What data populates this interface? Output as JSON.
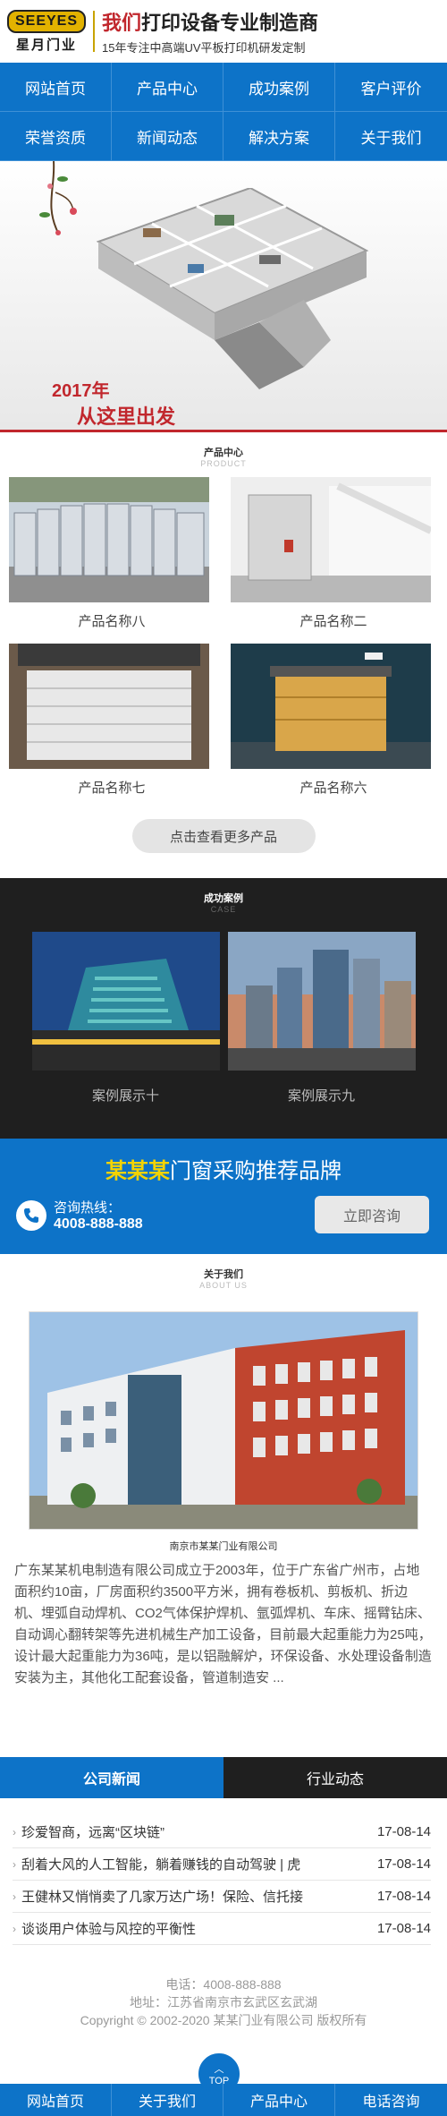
{
  "header": {
    "logo_top": "SEEYES",
    "logo_bottom": "星月门业",
    "headline_red": "我们",
    "headline_rest": "打印设备专业制造商",
    "subline": "15年专注中高端UV平板打印机研发定制"
  },
  "nav": [
    "网站首页",
    "产品中心",
    "成功案例",
    "客户评价",
    "荣誉资质",
    "新闻动态",
    "解决方案",
    "关于我们"
  ],
  "banner": {
    "year": "2017年",
    "slogan": "从这里出发"
  },
  "products": {
    "title": "产品中心",
    "subtitle": "PRODUCT",
    "items": [
      "产品名称八",
      "产品名称二",
      "产品名称七",
      "产品名称六"
    ],
    "more": "点击查看更多产品"
  },
  "cases": {
    "title": "成功案例",
    "subtitle": "CASE",
    "items": [
      "案例展示十",
      "案例展示九"
    ]
  },
  "hotline": {
    "brand": "某某某",
    "title_rest": "门窗采购推荐品牌",
    "label": "咨询热线：",
    "number": "4008-888-888",
    "button": "立即咨询"
  },
  "about": {
    "title": "关于我们",
    "subtitle": "ABOUT US",
    "caption": "南京市某某门业有限公司",
    "text": "广东某某机电制造有限公司成立于2003年，位于广东省广州市，占地面积约10亩，厂房面积约3500平方米，拥有卷板机、剪板机、折边机、埋弧自动焊机、CO2气体保护焊机、氩弧焊机、车床、摇臂钻床、自动调心翻转架等先进机械生产加工设备，目前最大起重能力为25吨，设计最大起重能力为36吨，是以铝融解炉，环保设备、水处理设备制造安装为主，其他化工配套设备，管道制造安 ..."
  },
  "news": {
    "tabs": [
      "公司新闻",
      "行业动态"
    ],
    "items": [
      {
        "title": "珍爱智商，远离“区块链”",
        "date": "17-08-14"
      },
      {
        "title": "刮着大风的人工智能，躺着赚钱的自动驾驶 | 虎",
        "date": "17-08-14"
      },
      {
        "title": "王健林又悄悄卖了几家万达广场！保险、信托接",
        "date": "17-08-14"
      },
      {
        "title": "谈谈用户体验与风控的平衡性",
        "date": "17-08-14"
      }
    ]
  },
  "footer": {
    "phone": "电话：4008-888-888",
    "address": "地址：江苏省南京市玄武区玄武湖",
    "copyright": "Copyright © 2002-2020 某某门业有限公司 版权所有"
  },
  "bottom_bar": [
    "网站首页",
    "关于我们",
    "产品中心",
    "电话咨询"
  ],
  "top_button": "TOP",
  "colors": {
    "primary": "#0d73c8",
    "accent_red": "#c1272d",
    "dark": "#1f1f1f",
    "brand_yellow": "#f5d300"
  }
}
